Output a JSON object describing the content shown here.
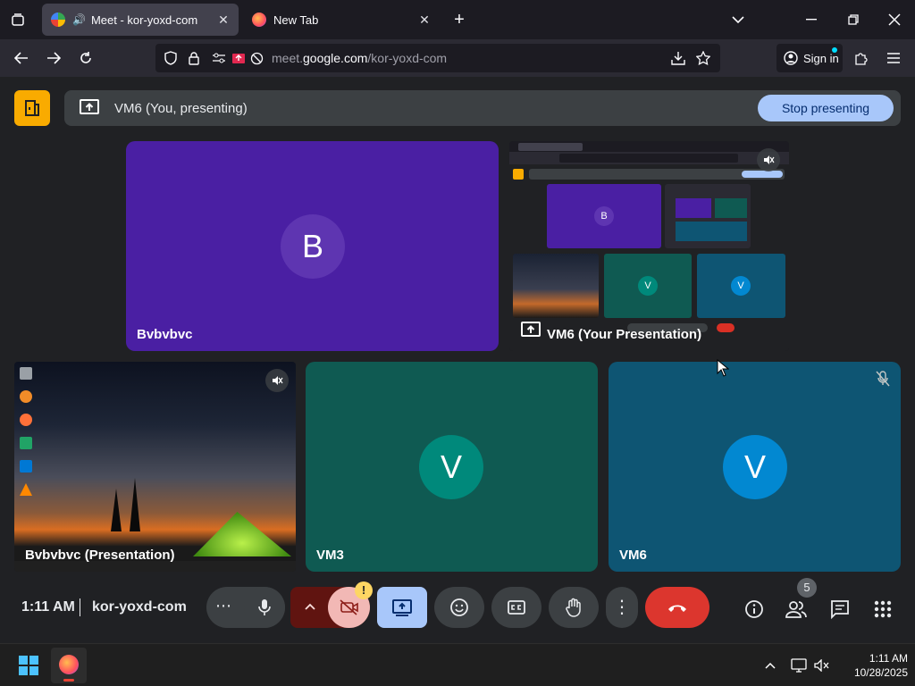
{
  "browser": {
    "tabs": [
      {
        "title": "Meet - kor-yoxd-com",
        "active": true
      },
      {
        "title": "New Tab",
        "active": false
      }
    ],
    "url_prefix": "meet.",
    "url_domain": "google.com",
    "url_path": "/kor-yoxd-com",
    "sign_in_label": "Sign in"
  },
  "presenting_bar": {
    "label": "VM6 (You, presenting)",
    "stop_label": "Stop presenting"
  },
  "tiles": [
    {
      "name": "Bvbvbvc",
      "initial": "B",
      "color": "#4a1fa3"
    },
    {
      "name": "VM6 (Your Presentation)"
    },
    {
      "name": "Bvbvbvc (Presentation)"
    },
    {
      "name": "VM3",
      "initial": "V",
      "color": "#0f5a52"
    },
    {
      "name": "VM6",
      "initial": "V",
      "color": "#0e5573"
    }
  ],
  "controls": {
    "time": "1:11 AM",
    "meeting_code": "kor-yoxd-com",
    "participant_count": "5",
    "camera_warning": "!"
  },
  "taskbar": {
    "time": "1:11 AM",
    "date": "10/28/2025"
  },
  "nested": {
    "tile_b": "B",
    "tile_v1": "V",
    "tile_v2": "V"
  }
}
